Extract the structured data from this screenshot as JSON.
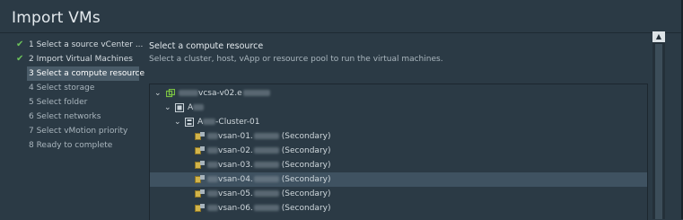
{
  "dialog": {
    "title": "Import VMs"
  },
  "steps": [
    {
      "label": "1 Select a source vCenter ...",
      "state": "done"
    },
    {
      "label": "2 Import Virtual Machines",
      "state": "done"
    },
    {
      "label": "3 Select a compute resource",
      "state": "active"
    },
    {
      "label": "4 Select storage",
      "state": "pending"
    },
    {
      "label": "5 Select folder",
      "state": "pending"
    },
    {
      "label": "6 Select networks",
      "state": "pending"
    },
    {
      "label": "7 Select vMotion priority",
      "state": "pending"
    },
    {
      "label": "8 Ready to complete",
      "state": "pending"
    }
  ],
  "main": {
    "heading": "Select a compute resource",
    "description": "Select a cluster, host, vApp or resource pool to run the virtual machines."
  },
  "tree": {
    "vcenter": {
      "label_suffix": "vcsa-v02.e",
      "icon": "vcenter-icon"
    },
    "datacenter": {
      "label_prefix": "A",
      "icon": "datacenter-icon"
    },
    "cluster": {
      "label_prefix": "A",
      "label_suffix": "-Cluster-01",
      "icon": "cluster-icon"
    },
    "hosts": [
      {
        "name": "vsan-01.",
        "tag": "(Secondary)",
        "selected": false
      },
      {
        "name": "vsan-02.",
        "tag": "(Secondary)",
        "selected": false
      },
      {
        "name": "vsan-03.",
        "tag": "(Secondary)",
        "selected": false
      },
      {
        "name": "vsan-04.",
        "tag": "(Secondary)",
        "selected": true
      },
      {
        "name": "vsan-05.",
        "tag": "(Secondary)",
        "selected": false
      },
      {
        "name": "vsan-06.",
        "tag": "(Secondary)",
        "selected": false
      }
    ]
  },
  "colors": {
    "background": "#2b3a45",
    "check": "#6cc25b",
    "selected_row": "#3f5261",
    "host_icon": "#d2b44a",
    "vcenter_icon": "#7ac143"
  }
}
